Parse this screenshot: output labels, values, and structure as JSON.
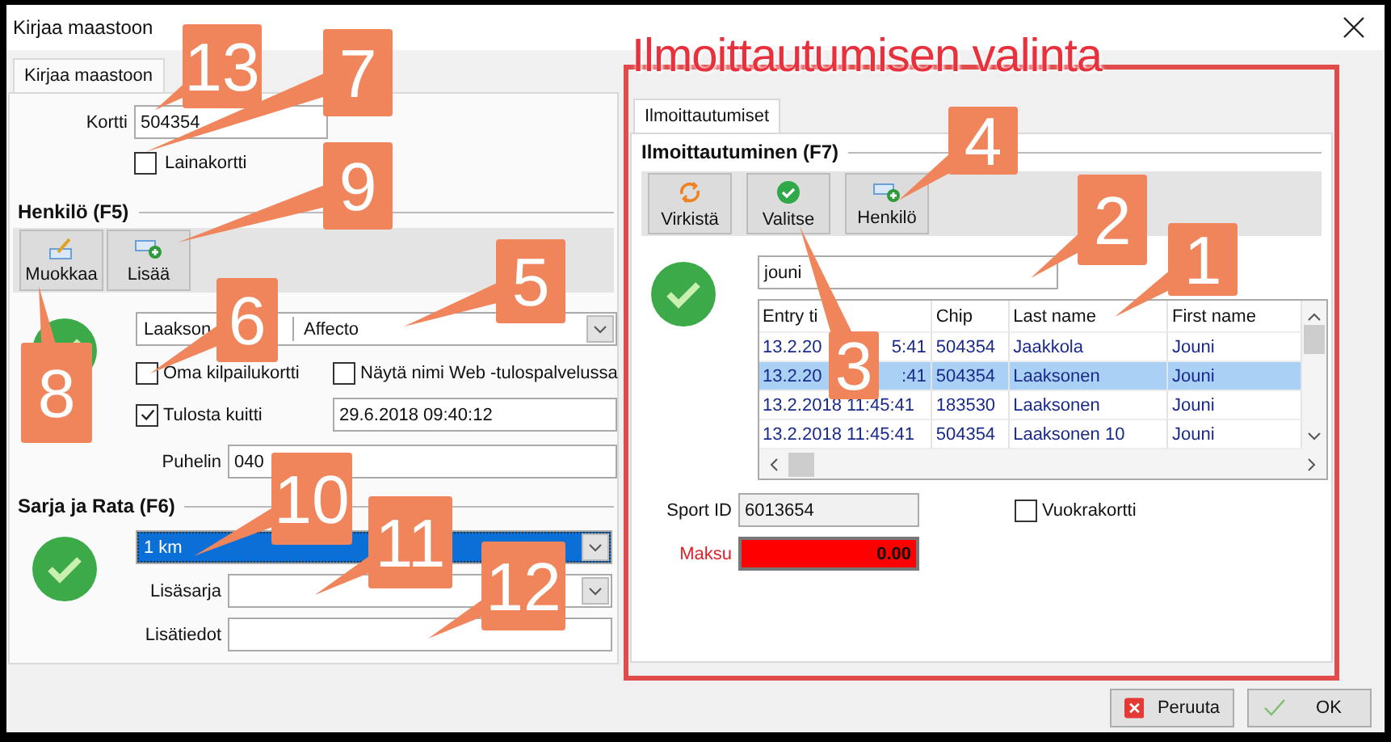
{
  "window": {
    "title": "Kirjaa maastoon"
  },
  "left_tab": {
    "label": "Kirjaa maastoon",
    "selected": true
  },
  "card": {
    "label": "Kortti",
    "value": "504354"
  },
  "loan_card": {
    "label": "Lainakortti",
    "checked": false
  },
  "person": {
    "heading": "Henkilö (F5)",
    "buttons": [
      {
        "label": "Muokkaa",
        "kind": "edit"
      },
      {
        "label": "Lisää",
        "kind": "add"
      }
    ],
    "name": "Laakson",
    "club": "Affecto",
    "checks": [
      {
        "label": "Oma kilpailukortti",
        "checked": false
      },
      {
        "label": "Näytä nimi Web -tulospalvelussa",
        "checked": false
      }
    ],
    "print_receipt": {
      "label": "Tulosta kuitti",
      "checked": true
    },
    "timestamp": "29.6.2018 09:40:12",
    "phone": {
      "label": "Puhelin",
      "value": "040"
    }
  },
  "class_course": {
    "heading": "Sarja ja Rata (F6)",
    "course": {
      "value": "1 km",
      "selected": true
    },
    "extra_class": {
      "label": "Lisäsarja"
    },
    "extra_info": {
      "label": "Lisätiedot"
    }
  },
  "registration": {
    "annotation": "Ilmoittautumisen valinta",
    "tab": {
      "label": "Ilmoittautumiset",
      "selected": true
    },
    "heading": "Ilmoittautuminen (F7)",
    "buttons": [
      {
        "label": "Virkistä",
        "kind": "refresh"
      },
      {
        "label": "Valitse",
        "kind": "select"
      },
      {
        "label": "Henkilö",
        "kind": "person"
      }
    ],
    "search": {
      "value": "jouni"
    },
    "table": {
      "columns": [
        "Entry ti",
        "Chip",
        "Last name",
        "First name"
      ],
      "rows": [
        {
          "entry_time": "13.2.20",
          "entry_time_end": "5:41",
          "chip": "504354",
          "last_name": "Jaakkola",
          "first_name": "Jouni",
          "selected": false
        },
        {
          "entry_time": "13.2.20",
          "entry_time_end": ":41",
          "chip": "504354",
          "last_name": "Laaksonen",
          "first_name": "Jouni",
          "selected": true
        },
        {
          "entry_time": "13.2.2018 11:45:41",
          "chip": "183530",
          "last_name": "Laaksonen",
          "first_name": "Jouni",
          "selected": false
        },
        {
          "entry_time": "13.2.2018 11:45:41",
          "chip": "504354",
          "last_name": "Laaksonen 10",
          "first_name": "Jouni",
          "selected": false
        }
      ]
    },
    "sport_id": {
      "label": "Sport ID",
      "value": "6013654"
    },
    "rental_card": {
      "label": "Vuokrakortti",
      "checked": false
    },
    "payment": {
      "label": "Maksu",
      "value": "0.00"
    }
  },
  "buttons": [
    {
      "label": "Peruuta",
      "kind": "cancel"
    },
    {
      "label": "OK",
      "kind": "ok"
    }
  ],
  "callouts": [
    {
      "number": "13"
    },
    {
      "number": "7"
    },
    {
      "number": "9"
    },
    {
      "number": "5"
    },
    {
      "number": "6"
    },
    {
      "number": "8"
    },
    {
      "number": "10"
    },
    {
      "number": "11"
    },
    {
      "number": "12"
    },
    {
      "number": "4"
    },
    {
      "number": "2"
    },
    {
      "number": "1"
    },
    {
      "number": "3"
    }
  ]
}
